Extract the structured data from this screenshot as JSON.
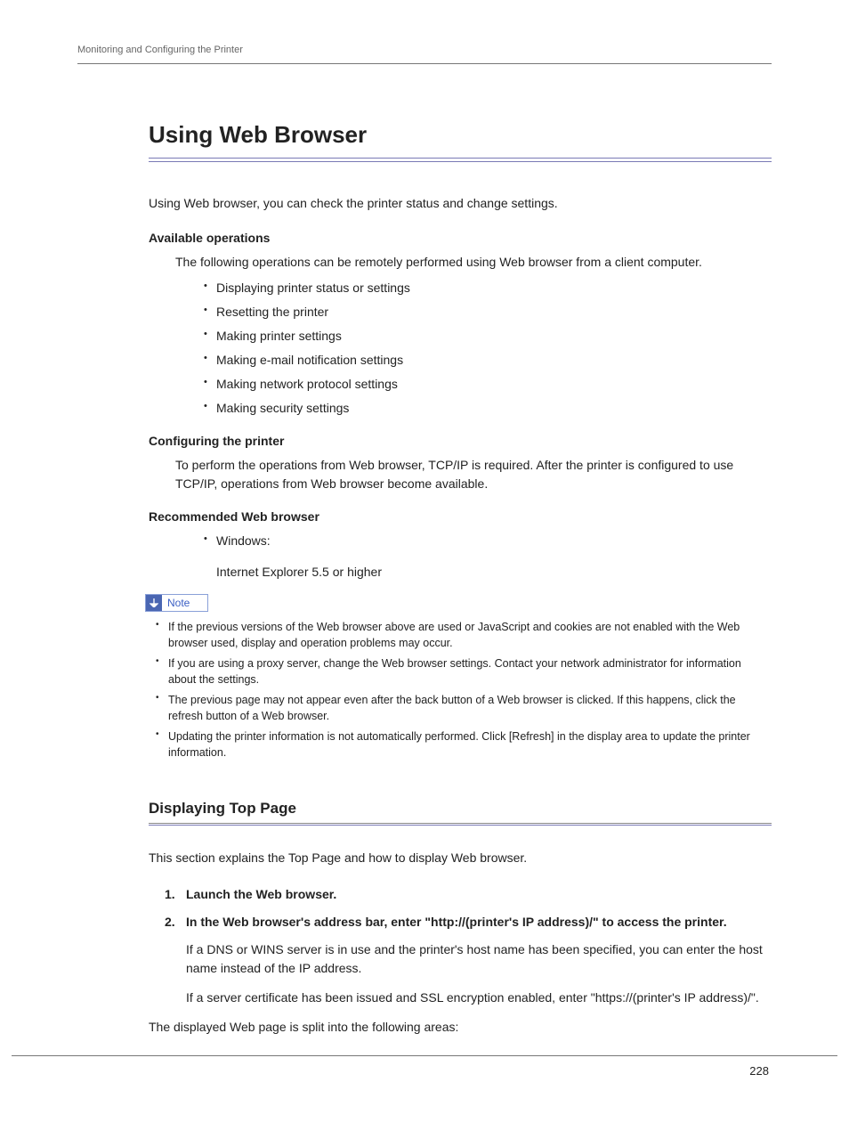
{
  "running_head": "Monitoring and Configuring the Printer",
  "chapter_title": "Using Web Browser",
  "intro": "Using Web browser, you can check the printer status and change settings.",
  "available_ops": {
    "heading": "Available operations",
    "lead_in": "The following operations can be remotely performed using Web browser from a client computer.",
    "items": [
      "Displaying printer status or settings",
      "Resetting the printer",
      "Making printer settings",
      "Making e-mail notification settings",
      "Making network protocol settings",
      "Making security settings"
    ]
  },
  "configuring": {
    "heading": "Configuring the printer",
    "body": "To perform the operations from Web browser, TCP/IP is required. After the printer is configured to use TCP/IP, operations from Web browser become available."
  },
  "recommended": {
    "heading": "Recommended Web browser",
    "item": "Windows:",
    "detail": "Internet Explorer 5.5 or higher"
  },
  "note": {
    "label": "Note",
    "items": [
      "If the previous versions of the Web browser above are used or JavaScript and cookies are not enabled with the Web browser used, display and operation problems may occur.",
      "If you are using a proxy server, change the Web browser settings. Contact your network administrator for information about the settings.",
      "The previous page may not appear even after the back button of a Web browser is clicked. If this happens, click the refresh button of a Web browser.",
      "Updating the printer information is not automatically performed. Click [Refresh] in the display area to update the printer information."
    ]
  },
  "section": {
    "title": "Displaying Top Page",
    "intro": "This section explains the Top Page and how to display Web browser.",
    "steps": [
      {
        "num": "1.",
        "text": "Launch the Web browser."
      },
      {
        "num": "2.",
        "text": "In the Web browser's address bar, enter \"http://(printer's IP address)/\" to access the printer.",
        "body": [
          "If a DNS or WINS server is in use and the printer's host name has been specified, you can enter the host name instead of the IP address.",
          "If a server certificate has been issued and SSL encryption enabled, enter \"https://(printer's IP address)/\"."
        ]
      }
    ],
    "after": "The displayed Web page is split into the following areas:"
  },
  "page_number": "228"
}
